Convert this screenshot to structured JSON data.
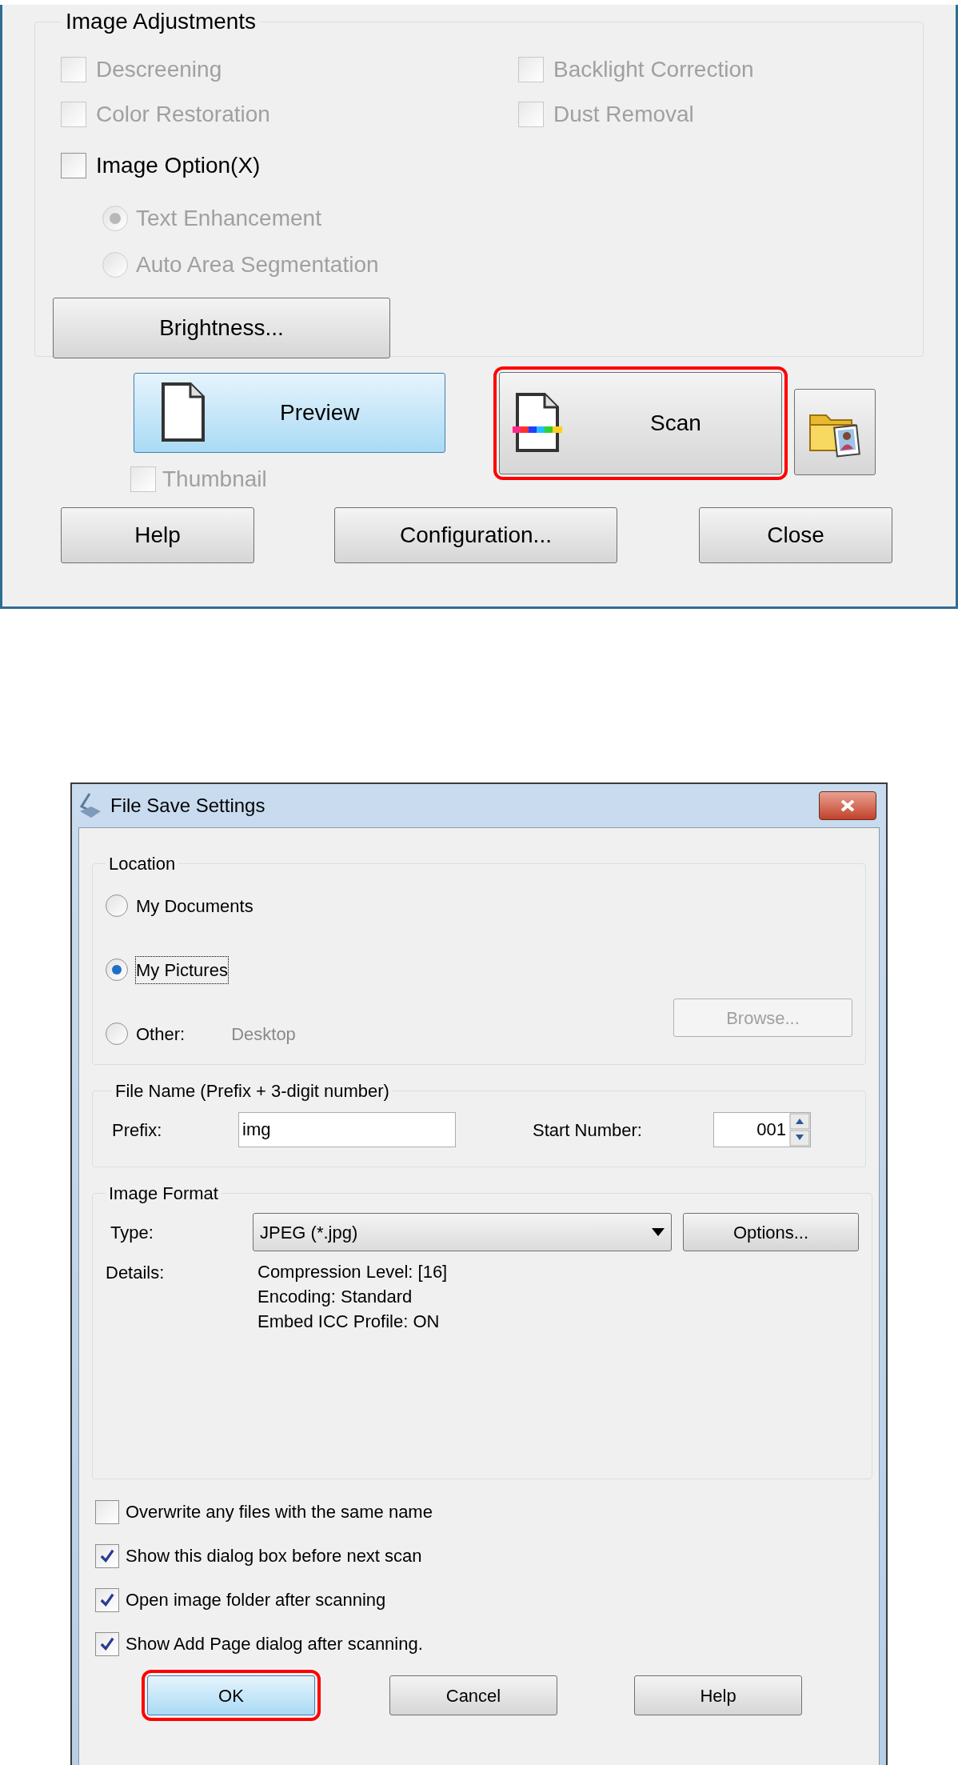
{
  "scan_dialog": {
    "image_adjustments": {
      "title": "Image Adjustments",
      "options": [
        {
          "label": "Descreening",
          "checked": false,
          "disabled": true
        },
        {
          "label": "Backlight Correction",
          "checked": false,
          "disabled": true
        },
        {
          "label": "Color Restoration",
          "checked": false,
          "disabled": true
        },
        {
          "label": "Dust Removal",
          "checked": false,
          "disabled": true
        }
      ],
      "image_option": {
        "label": "Image Option(X)",
        "checked": false,
        "disabled": false
      },
      "modes": [
        {
          "label": "Text Enhancement",
          "selected": true,
          "disabled": true
        },
        {
          "label": "Auto Area Segmentation",
          "selected": false,
          "disabled": true
        }
      ],
      "brightness_button": "Brightness..."
    },
    "preview_button": {
      "label": "Preview",
      "focused": true,
      "highlighted": false
    },
    "scan_button": {
      "label": "Scan",
      "focused": false,
      "highlighted": true
    },
    "thumbnail": {
      "label": "Thumbnail",
      "checked": false,
      "disabled": true
    },
    "buttons": [
      {
        "label": "Help"
      },
      {
        "label": "Configuration..."
      },
      {
        "label": "Close"
      }
    ]
  },
  "file_save_dialog": {
    "title": "File Save Settings",
    "location": {
      "title": "Location",
      "options": [
        {
          "label": "My Documents",
          "selected": false
        },
        {
          "label": "My Pictures",
          "selected": true
        },
        {
          "label": "Other:",
          "selected": false
        }
      ],
      "other_path": "Desktop",
      "browse_button": {
        "label": "Browse...",
        "disabled": true
      }
    },
    "file_name": {
      "title": "File Name (Prefix + 3-digit number)",
      "prefix_label": "Prefix:",
      "prefix_value": "img",
      "start_number_label": "Start Number:",
      "start_number_value": "001"
    },
    "image_format": {
      "title": "Image Format",
      "type_label": "Type:",
      "type_value": "JPEG (*.jpg)",
      "options_button": "Options...",
      "details_label": "Details:",
      "details": [
        "Compression Level: [16]",
        "Encoding: Standard",
        "Embed ICC Profile: ON"
      ]
    },
    "checkboxes": [
      {
        "label": "Overwrite any files with the same name",
        "checked": false
      },
      {
        "label": "Show this dialog box before next scan",
        "checked": true
      },
      {
        "label": "Open image folder after scanning",
        "checked": true
      },
      {
        "label": "Show Add Page dialog after scanning.",
        "checked": true
      }
    ],
    "buttons": [
      {
        "label": "OK",
        "focused": true,
        "highlighted": true
      },
      {
        "label": "Cancel",
        "focused": false,
        "highlighted": false
      },
      {
        "label": "Help",
        "focused": false,
        "highlighted": false
      }
    ]
  }
}
